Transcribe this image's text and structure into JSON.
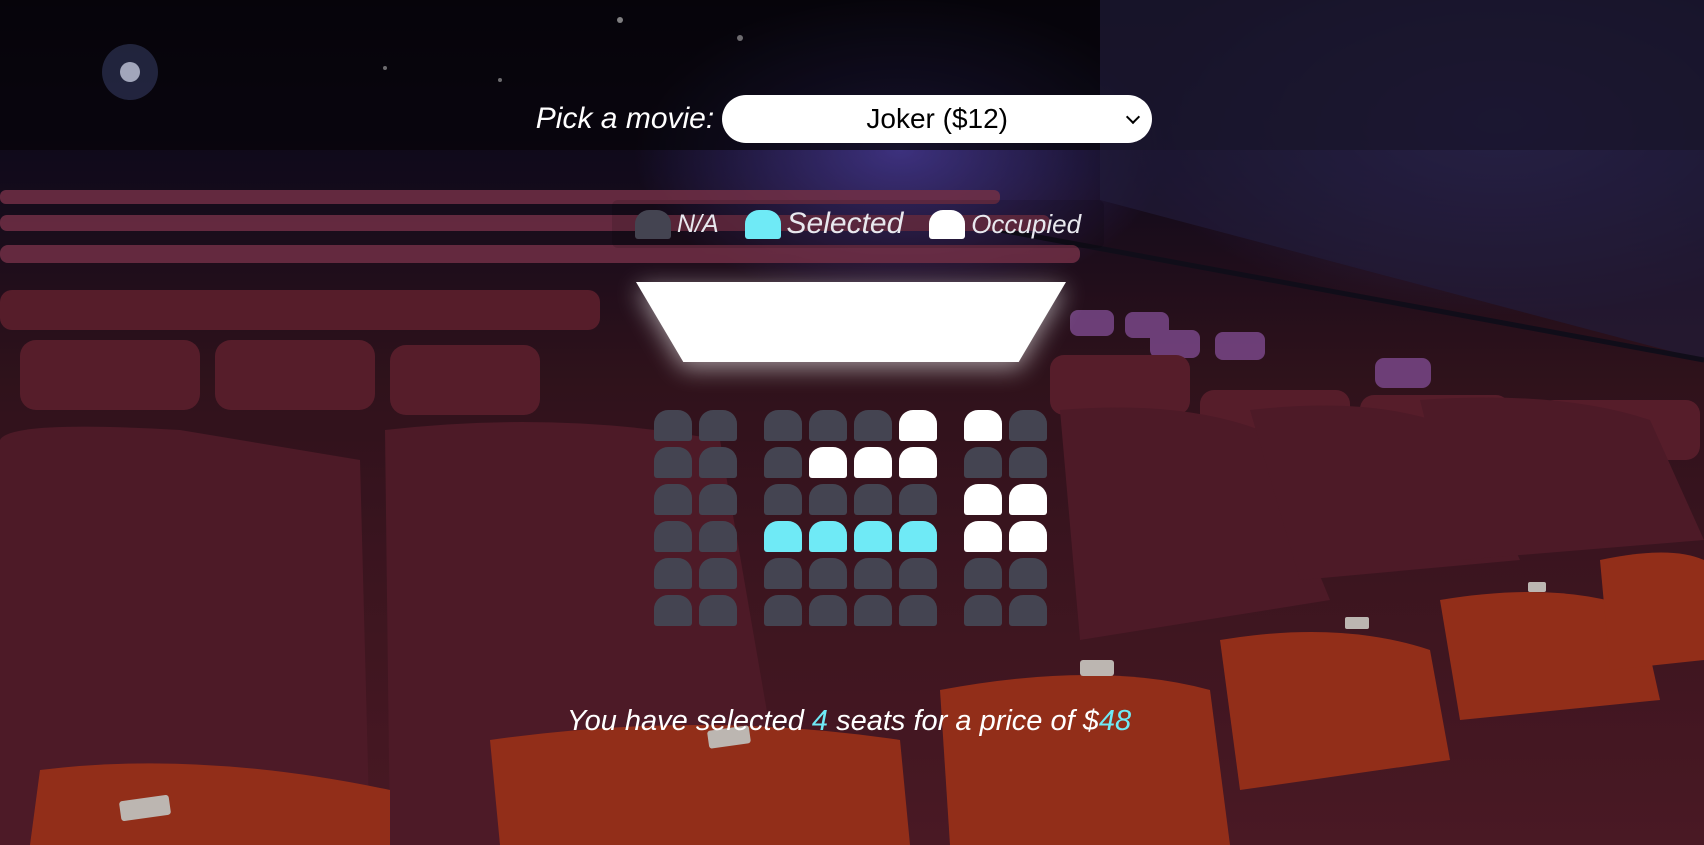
{
  "header": {
    "label": "Pick a movie:",
    "selected_movie": "Joker ($12)"
  },
  "legend": {
    "items": [
      {
        "status": "na",
        "label": "N/A",
        "color": "#444451"
      },
      {
        "status": "selected",
        "label": "Selected",
        "color": "#6feaf6"
      },
      {
        "status": "occupied",
        "label": "Occupied",
        "color": "#ffffff"
      }
    ]
  },
  "seats": {
    "rows": [
      [
        "na",
        "na",
        "na",
        "na",
        "na",
        "occupied",
        "occupied",
        "na"
      ],
      [
        "na",
        "na",
        "na",
        "occupied",
        "occupied",
        "occupied",
        "na",
        "na"
      ],
      [
        "na",
        "na",
        "na",
        "na",
        "na",
        "na",
        "occupied",
        "occupied"
      ],
      [
        "na",
        "na",
        "selected",
        "selected",
        "selected",
        "selected",
        "occupied",
        "occupied"
      ],
      [
        "na",
        "na",
        "na",
        "na",
        "na",
        "na",
        "na",
        "na"
      ],
      [
        "na",
        "na",
        "na",
        "na",
        "na",
        "na",
        "na",
        "na"
      ]
    ]
  },
  "summary": {
    "prefix": "You have selected ",
    "count": "4",
    "middle": " seats for a price of $",
    "price": "48"
  },
  "colors": {
    "accent": "#6feaf6",
    "seat_na": "#444451",
    "seat_occupied": "#ffffff"
  }
}
